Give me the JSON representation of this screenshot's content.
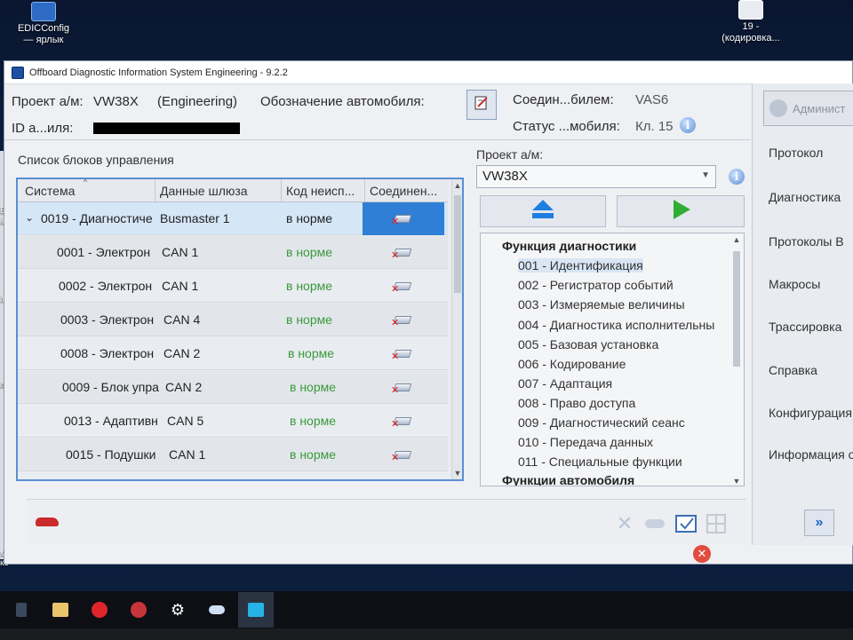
{
  "desktop": {
    "icon_edic_label_1": "EDICConfig",
    "icon_edic_label_2": "— ярлык",
    "icon_19_label_1": "19 -",
    "icon_19_label_2": "(кодировка..."
  },
  "window": {
    "title": "Offboard Diagnostic Information System Engineering - 9.2.2"
  },
  "header": {
    "project_label": "Проект а/м:",
    "project_value": "VW38X",
    "project_mode": "(Engineering)",
    "designation_label": "Обозначение автомобиля:",
    "id_label": "ID а...иля:",
    "connection_label": "Соедин...билем:",
    "connection_value": "VAS6",
    "status_label": "Статус ...мобиля:",
    "status_value": "Кл. 15"
  },
  "control_units": {
    "caption": "Список блоков управления",
    "columns": [
      "Система",
      "Данные шлюза",
      "Код неисп...",
      "Соединен..."
    ],
    "rows": [
      {
        "system": "0019 - Диагностиче",
        "gateway": "Busmaster 1",
        "status": "в норме"
      },
      {
        "system": "0001 - Электрон",
        "gateway": "CAN 1",
        "status": "в норме"
      },
      {
        "system": "0002 - Электрон",
        "gateway": "CAN 1",
        "status": "в норме"
      },
      {
        "system": "0003 - Электрон",
        "gateway": "CAN 4",
        "status": "в норме"
      },
      {
        "system": "0008 - Электрон",
        "gateway": "CAN 2",
        "status": "в норме"
      },
      {
        "system": "0009 - Блок упра",
        "gateway": "CAN 2",
        "status": "в норме"
      },
      {
        "system": "0013 - Адаптивн",
        "gateway": "CAN 5",
        "status": "в норме"
      },
      {
        "system": "0015 - Подушки",
        "gateway": "CAN 1",
        "status": "в норме"
      }
    ]
  },
  "middle": {
    "project_caption": "Проект а/м:",
    "project_selected": "VW38X",
    "group_diagnostics": "Функция диагностики",
    "functions": [
      "001 - Идентификация",
      "002 - Регистратор событий",
      "003 - Измеряемые величины",
      "004 - Диагностика исполнительны",
      "005 - Базовая установка",
      "006 - Кодирование",
      "007 - Адаптация",
      "008 - Право доступа",
      "009 - Диагностический сеанс",
      "010 - Передача данных",
      "011 - Специальные функции"
    ],
    "group_vehicle": "Функции автомобиля"
  },
  "sidebar": {
    "admin_label": "Админист",
    "items": [
      "Протокол",
      "Диагностика",
      "Протоколы В",
      "Макросы",
      "Трассировка",
      "Справка",
      "Конфигурация",
      "Информация о"
    ]
  },
  "desktop_left": {
    "fragment_1": "EDI",
    "fragment_2": "ide",
    "fragment_3": "ity",
    "fragment_4": "aner",
    "fragment_5": "мат ко"
  },
  "colors": {
    "accent": "#2f7fd6",
    "ok_green": "#3a9a3a",
    "error_red": "#d22222"
  }
}
